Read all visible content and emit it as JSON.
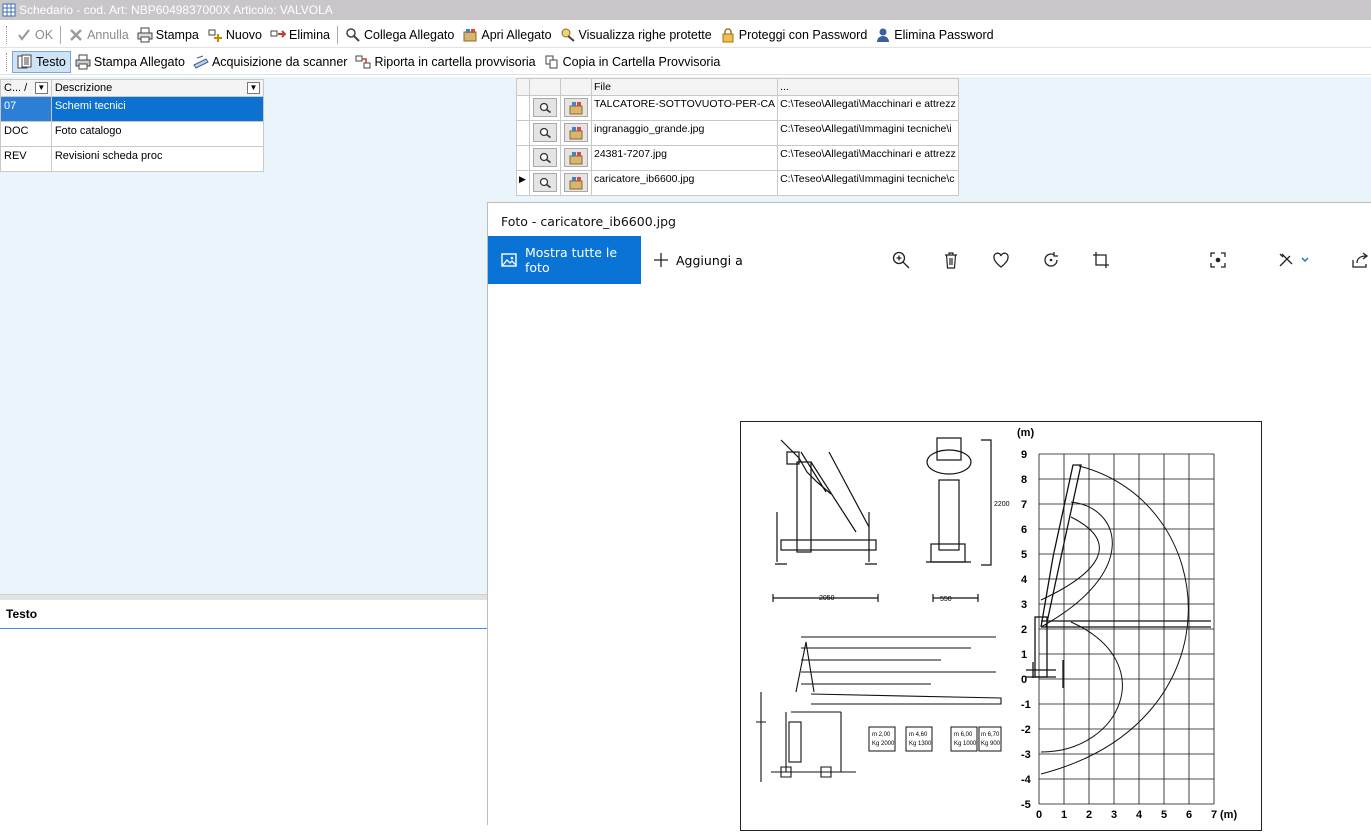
{
  "window": {
    "title": "Schedario - cod. Art: NBP6049837000X Articolo: VALVOLA",
    "icon": "app-grid-icon"
  },
  "toolbar1": {
    "ok": "OK",
    "annulla": "Annulla",
    "stampa": "Stampa",
    "nuovo": "Nuovo",
    "elimina": "Elimina",
    "collega": "Collega Allegato",
    "apri": "Apri Allegato",
    "visualizza": "Visualizza righe protette",
    "proteggi": "Proteggi con Password",
    "elimina_pw": "Elimina Password"
  },
  "toolbar2": {
    "testo": "Testo",
    "stampa_allegato": "Stampa Allegato",
    "acquisizione": "Acquisizione da scanner",
    "riporta": "Riporta in cartella provvisoria",
    "copia": "Copia in Cartella Provvisoria"
  },
  "categories": {
    "headers": [
      "C... /",
      "Descrizione"
    ],
    "rows": [
      {
        "code": "07",
        "desc": "Schemi tecnici",
        "selected": true
      },
      {
        "code": "DOC",
        "desc": "Foto catalogo",
        "selected": false
      },
      {
        "code": "REV",
        "desc": "Revisioni scheda proc",
        "selected": false
      }
    ]
  },
  "files": {
    "headers": [
      "File",
      "..."
    ],
    "rows": [
      {
        "file": "TALCATORE-SOTTOVUOTO-PER-CA",
        "path": "C:\\Teseo\\Allegati\\Macchinari e attrezz",
        "current": false
      },
      {
        "file": "ingranaggio_grande.jpg",
        "path": "C:\\Teseo\\Allegati\\Immagini tecniche\\i",
        "current": false
      },
      {
        "file": "24381-7207.jpg",
        "path": "C:\\Teseo\\Allegati\\Macchinari e attrezz",
        "current": false
      },
      {
        "file": "caricatore_ib6600.jpg",
        "path": "C:\\Teseo\\Allegati\\Immagini tecniche\\c",
        "current": true
      }
    ]
  },
  "text_panel": {
    "title": "Testo"
  },
  "photo_viewer": {
    "title": "Foto - caricatore_ib6600.jpg",
    "all_photos": "Mostra tutte le foto",
    "add_to": "Aggiungi a",
    "icons": [
      "zoom-in-icon",
      "delete-icon",
      "favorite-icon",
      "rotate-icon",
      "crop-icon",
      "visual-search-icon",
      "edit-icon",
      "share-icon"
    ]
  },
  "drawing": {
    "unit_label_y": "(m)",
    "unit_label_x": "(m)",
    "y_ticks": [
      "9",
      "8",
      "7",
      "6",
      "5",
      "4",
      "3",
      "2",
      "1",
      "0",
      "-1",
      "-2",
      "-3",
      "-4",
      "-5"
    ],
    "x_ticks": [
      "0",
      "1",
      "2",
      "3",
      "4",
      "5",
      "6",
      "7"
    ],
    "dims": [
      "2200",
      "2050",
      "550"
    ],
    "load_boxes": [
      {
        "reach": "m 2,00",
        "load": "Kg 2000"
      },
      {
        "reach": "m 4,60",
        "load": "Kg 1300"
      },
      {
        "reach": "m 6,00",
        "load": "Kg 1000"
      },
      {
        "reach": "m 6,70",
        "load": "Kg 900"
      }
    ]
  }
}
